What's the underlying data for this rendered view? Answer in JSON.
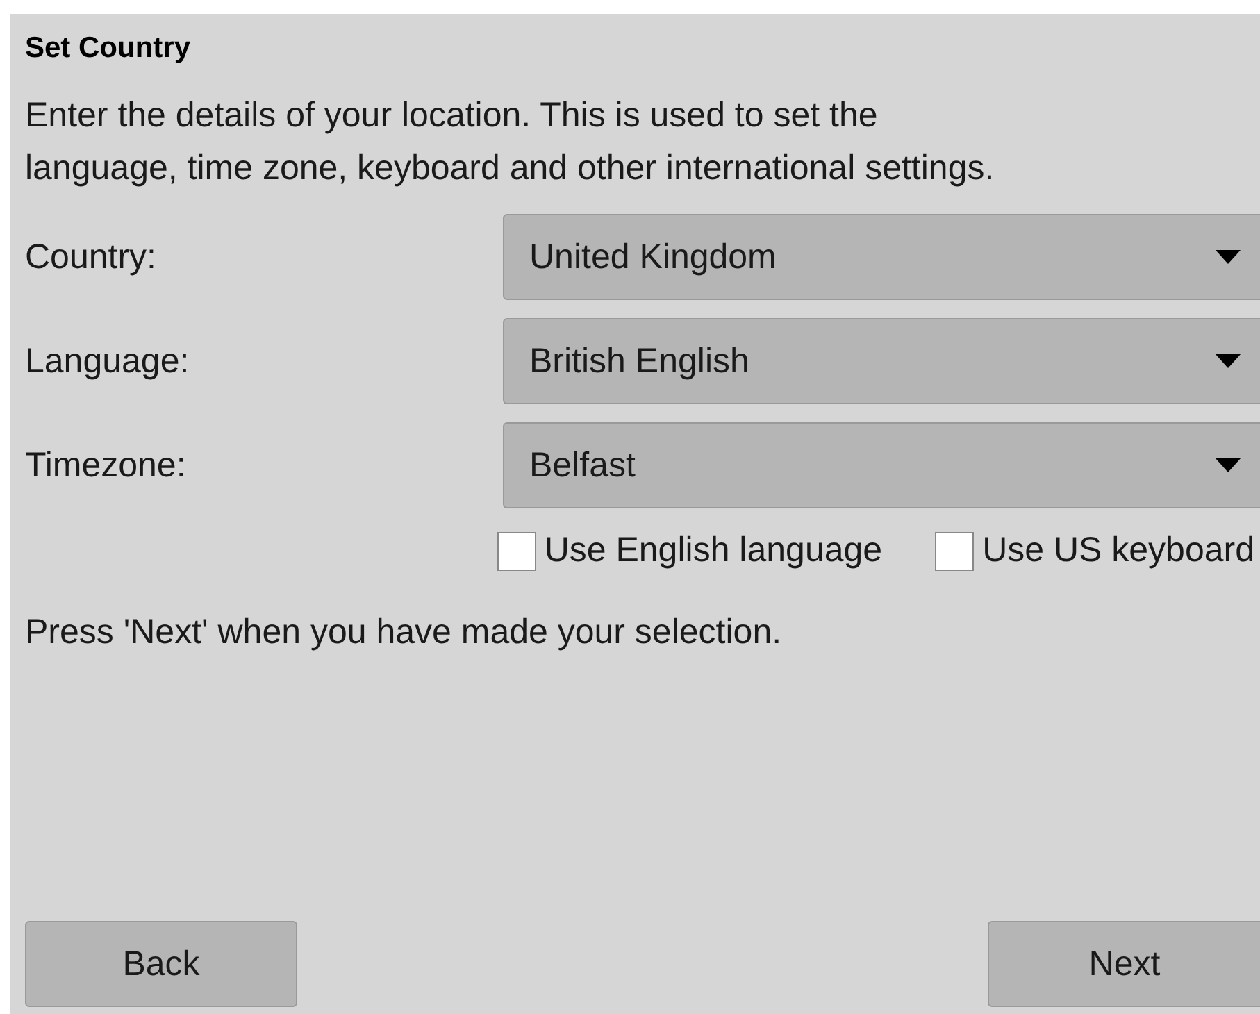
{
  "title": "Set Country",
  "intro": "Enter the details of your location. This is used to set the language, time zone, keyboard and other international settings.",
  "fields": [
    {
      "label": "Country:",
      "value": "United Kingdom"
    },
    {
      "label": "Language:",
      "value": "British English"
    },
    {
      "label": "Timezone:",
      "value": "Belfast"
    }
  ],
  "checkboxes": [
    {
      "label": "Use English language",
      "checked": false
    },
    {
      "label": "Use US keyboard",
      "checked": false
    }
  ],
  "hint": "Press 'Next' when you have made your selection.",
  "buttons": {
    "back": "Back",
    "next": "Next"
  }
}
